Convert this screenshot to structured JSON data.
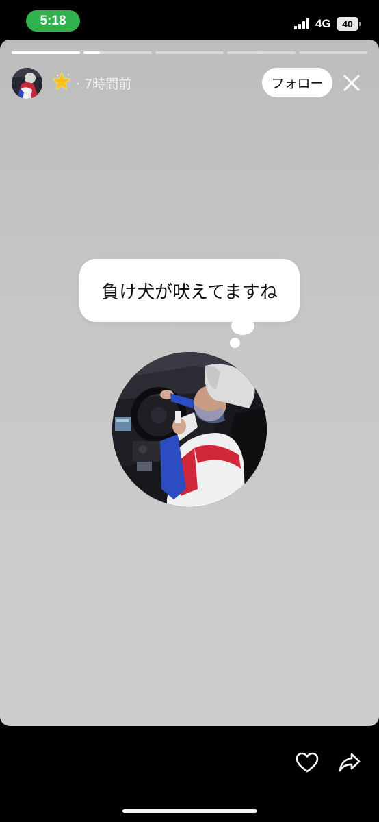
{
  "status_bar": {
    "time": "5:18",
    "network": "4G",
    "battery_level": "40",
    "clock_pill_color": "#2fb24c"
  },
  "story": {
    "progress": [
      1.0,
      0.24,
      0.0,
      0.0,
      0.0
    ],
    "header": {
      "avatar": "profile-avatar",
      "badge": "star-icon",
      "time_ago": "· 7時間前"
    },
    "follow_label": "フォロー",
    "close": "close-icon",
    "bubble_text": "負け犬が吠えてますね",
    "photo": "circular-profile-photo"
  },
  "actions": {
    "like": "heart-icon",
    "share": "share-icon"
  },
  "colors": {
    "background": "#000000",
    "card": "#c8c8c8",
    "bubble": "#ffffff"
  }
}
